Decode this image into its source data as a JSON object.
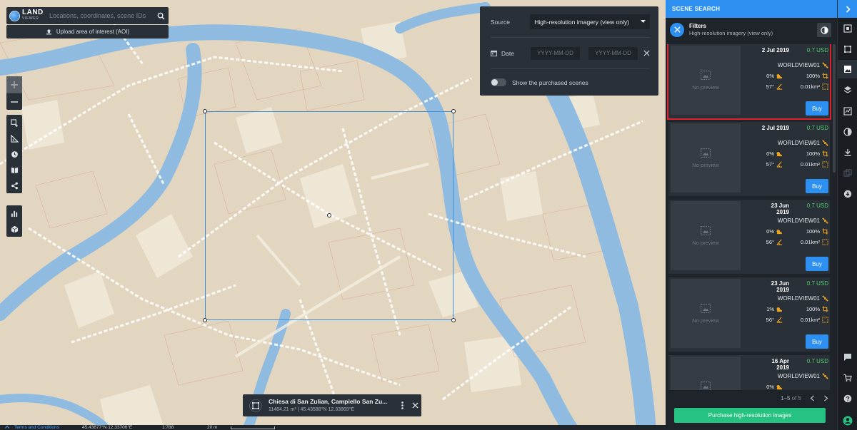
{
  "app": {
    "logo_line1": "LAND",
    "logo_line2": "VIEWER"
  },
  "search": {
    "placeholder": "Locations, coordinates, scene IDs",
    "upload_label": "Upload area of interest (AOI)"
  },
  "filters_panel": {
    "source_label": "Source",
    "source_value": "High-resolution imagery (view only)",
    "date_label": "Date",
    "date_from_placeholder": "YYYY-MM-DD",
    "date_to_placeholder": "YYYY-MM-DD",
    "show_purchased_label": "Show the purchased scenes"
  },
  "aoi_info": {
    "title": "Chiesa di San Zulian, Campiello San Zu...",
    "details": "11484.21 m² | 45.43588°N 12.33869°E"
  },
  "status_bar": {
    "terms": "Terms and Conditions",
    "coords": "45.43677°N 12.33706°E",
    "scale": "1:788",
    "scale_bar_label": "20 m"
  },
  "sidebar": {
    "header": "SCENE SEARCH",
    "filters_title": "Filters",
    "filters_subtitle": "High-resolution imagery (view only)",
    "no_preview": "No preview",
    "buy_label": "Buy",
    "pager_range": "1–5",
    "pager_of": "of 5",
    "purchase_label": "Purchase high-resolution images",
    "scenes": [
      {
        "date": "2 Jul 2019",
        "price": "0.7 USD",
        "satellite": "WORLDVIEW01",
        "cloud": "0%",
        "coverage": "100%",
        "angle": "57°",
        "area": "0.01km²"
      },
      {
        "date": "2 Jul 2019",
        "price": "0.7 USD",
        "satellite": "WORLDVIEW01",
        "cloud": "0%",
        "coverage": "100%",
        "angle": "57°",
        "area": "0.01km²"
      },
      {
        "date": "23 Jun 2019",
        "price": "0.7 USD",
        "satellite": "WORLDVIEW01",
        "cloud": "0%",
        "coverage": "100%",
        "angle": "56°",
        "area": "0.01km²"
      },
      {
        "date": "23 Jun 2019",
        "price": "0.7 USD",
        "satellite": "WORLDVIEW01",
        "cloud": "1%",
        "coverage": "100%",
        "angle": "56°",
        "area": "0.01km²"
      },
      {
        "date": "16 Apr 2019",
        "price": "0.7 USD",
        "satellite": "WORLDVIEW01",
        "cloud": "0%",
        "coverage": "",
        "angle": "",
        "area": ""
      }
    ]
  },
  "colors": {
    "accent": "#2d8ff0",
    "price": "#4fcf6a",
    "purchase": "#26c281",
    "selection": "#e0202a",
    "panel": "#2a3038",
    "canal": "#8fbbe0"
  }
}
